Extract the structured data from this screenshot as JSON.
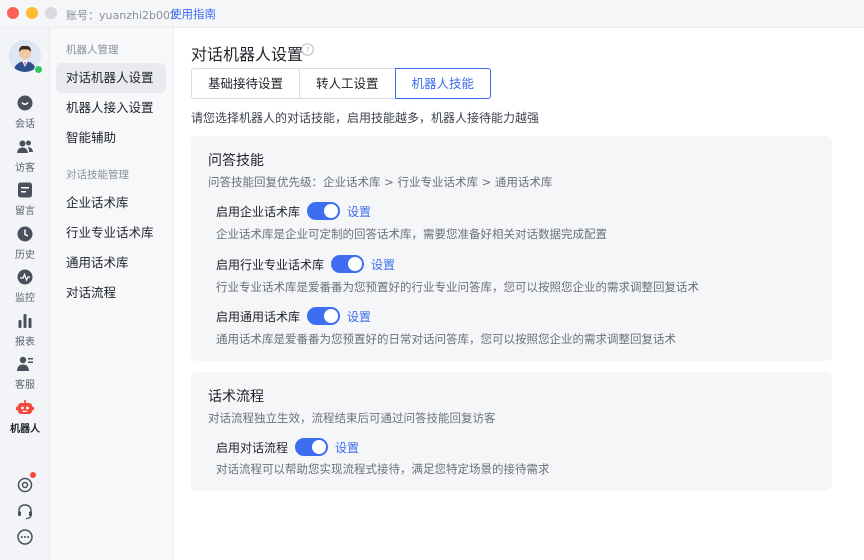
{
  "titlebar": {
    "account": "账号：yuanzhi2b002",
    "guide_link": "使用指南"
  },
  "rail": {
    "items": [
      {
        "label": "会话",
        "icon": "chat-icon"
      },
      {
        "label": "访客",
        "icon": "visitors-icon"
      },
      {
        "label": "留言",
        "icon": "message-icon"
      },
      {
        "label": "历史",
        "icon": "history-icon"
      },
      {
        "label": "监控",
        "icon": "monitor-icon"
      },
      {
        "label": "报表",
        "icon": "report-icon"
      },
      {
        "label": "客服",
        "icon": "agent-icon"
      },
      {
        "label": "机器人",
        "icon": "robot-icon"
      }
    ],
    "active": "机器人",
    "bottom_icons": [
      "settings-icon",
      "headset-icon",
      "more-icon"
    ],
    "accent_color": "#f5483b"
  },
  "subnav": {
    "group1": "机器人管理",
    "group1_items": [
      "对话机器人设置",
      "机器人接入设置",
      "智能辅助"
    ],
    "group2": "对话技能管理",
    "group2_items": [
      "企业话术库",
      "行业专业话术库",
      "通用话术库",
      "对话流程"
    ],
    "active": "对话机器人设置"
  },
  "main": {
    "title": "对话机器人设置",
    "tabs": [
      "基础接待设置",
      "转人工设置",
      "机器人技能"
    ],
    "active_tab": "机器人技能",
    "intro": "请您选择机器人的对话技能，启用技能越多，机器人接待能力越强",
    "qa_card": {
      "title": "问答技能",
      "priority": "问答技能回复优先级：企业话术库 > 行业专业话术库 > 通用话术库",
      "skills": [
        {
          "label": "启用企业话术库",
          "enabled": true,
          "link": "设置",
          "desc": "企业话术库是企业可定制的回答话术库，需要您准备好相关对话数据完成配置"
        },
        {
          "label": "启用行业专业话术库",
          "enabled": true,
          "link": "设置",
          "desc": "行业专业话术库是爱番番为您预置好的行业专业问答库，您可以按照您企业的需求调整回复话术"
        },
        {
          "label": "启用通用话术库",
          "enabled": true,
          "link": "设置",
          "desc": "通用话术库是爱番番为您预置好的日常对话问答库，您可以按照您企业的需求调整回复话术"
        }
      ]
    },
    "flow_card": {
      "title": "话术流程",
      "subtitle": "对话流程独立生效，流程结束后可通过问答技能回复访客",
      "skills": [
        {
          "label": "启用对话流程",
          "enabled": true,
          "link": "设置",
          "desc": "对话流程可以帮助您实现流程式接待，满足您特定场景的接待需求"
        }
      ]
    },
    "accent_color": "#3d6df0"
  }
}
